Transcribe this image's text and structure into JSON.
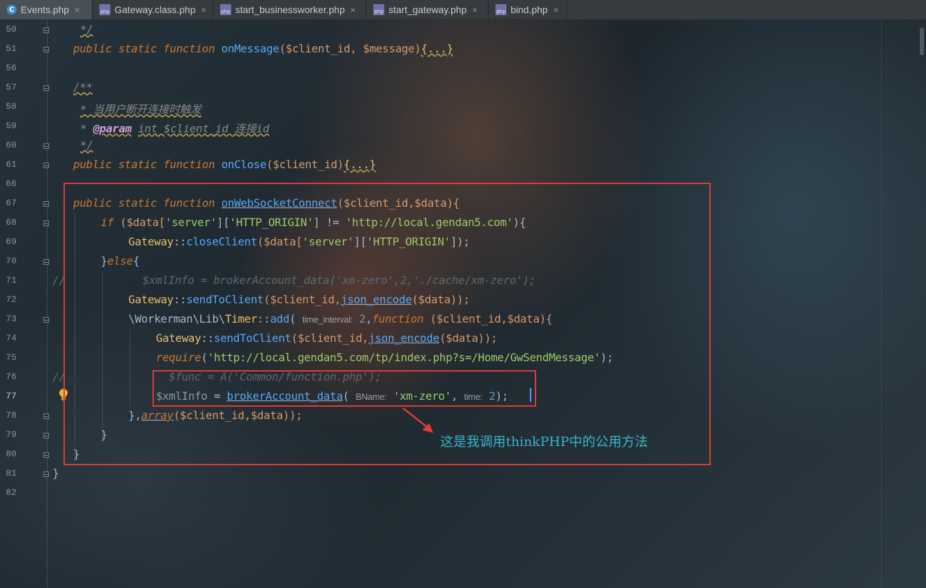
{
  "tabs": [
    {
      "label": "Events.php",
      "icon": "php-class-icon",
      "active": true
    },
    {
      "label": "Gateway.class.php",
      "icon": "php-file-icon",
      "active": false
    },
    {
      "label": "start_businessworker.php",
      "icon": "php-file-icon",
      "active": false
    },
    {
      "label": "start_gateway.php",
      "icon": "php-file-icon",
      "active": false
    },
    {
      "label": "bind.php",
      "icon": "php-file-icon",
      "active": false
    }
  ],
  "tab_close_glyph": "×",
  "class_icon_letter": "C",
  "php_icon_text": "php",
  "line_numbers": [
    "50",
    "51",
    "56",
    "57",
    "58",
    "59",
    "60",
    "61",
    "66",
    "67",
    "68",
    "69",
    "70",
    "71",
    "72",
    "73",
    "74",
    "75",
    "76",
    "77",
    "78",
    "79",
    "80",
    "81",
    "82"
  ],
  "code": {
    "l50": "*/",
    "l51_kw": "public static function",
    "l51_fn": "onMessage",
    "l51_args": "($client_id, $message)",
    "l51_fold": "{...}",
    "l57": "/**",
    "l58": "* 当用户断开连接时触发",
    "l59_star": "*",
    "l59_tag": "@param",
    "l59_rest": "int $client_id 连接id",
    "l60": "*/",
    "l61_kw": "public static function",
    "l61_fn": "onClose",
    "l61_args": "($client_id)",
    "l61_fold": "{...}",
    "l67_kw": "public static function",
    "l67_fn": "onWebSocketConnect",
    "l67_args": "($client_id,$data){",
    "l68_if": "if",
    "l68_a": "($data[",
    "l68_s1": "'server'",
    "l68_b": "][",
    "l68_s2": "'HTTP_ORIGIN'",
    "l68_c": "] != ",
    "l68_s3": "'http://local.gendan5.com'",
    "l68_d": "){",
    "l69_cls": "Gateway",
    "l69_a": "::",
    "l69_fn": "closeClient",
    "l69_b": "($data[",
    "l69_s1": "'server'",
    "l69_c": "][",
    "l69_s2": "'HTTP_ORIGIN'",
    "l69_d": "]);",
    "l70_a": "}",
    "l70_kw": "else",
    "l70_b": "{",
    "l71_slashes": "//",
    "l71_rest": "$xmlInfo = brokerAccount_data('xm-zero',2,'./cache/xm-zero');",
    "l72_cls": "Gateway",
    "l72_a": "::",
    "l72_fn": "sendToClient",
    "l72_b": "($client_id,",
    "l72_fn2": "json_encode",
    "l72_c": "($data));",
    "l73_a": "\\Workerman\\Lib\\",
    "l73_cls": "Timer",
    "l73_b": "::",
    "l73_fn": "add",
    "l73_c": "( ",
    "l73_hint": "time_interval:",
    "l73_num": " 2",
    "l73_d": ",",
    "l73_kw": "function",
    "l73_e": " ($client_id,$data){",
    "l74_cls": "Gateway",
    "l74_a": "::",
    "l74_fn": "sendToClient",
    "l74_b": "($client_id,",
    "l74_fn2": "json_encode",
    "l74_c": "($data));",
    "l75_kw": "require",
    "l75_a": "(",
    "l75_s": "'http://local.gendan5.com/tp/index.php?s=/Home/GwSendMessage'",
    "l75_b": ");",
    "l76_slashes": "//",
    "l76_rest": "$func = A('Common/function.php');",
    "l77_var": "$xmlInfo",
    "l77_a": " = ",
    "l77_fn": "brokerAccount_data",
    "l77_b": "( ",
    "l77_hint1": "BName:",
    "l77_s": " 'xm-zero'",
    "l77_c": ", ",
    "l77_hint2": "time:",
    "l77_num": " 2",
    "l77_d": ");",
    "l78_a": "},",
    "l78_kw": "array",
    "l78_b": "($client_id,$data));",
    "l79": "}",
    "l80": "}",
    "l81": "}"
  },
  "annotation": "这是我调用thinkPHP中的公用方法",
  "colors": {
    "highlight_box": "#e23a3a",
    "note_text": "#3ab7c6",
    "keyword": "#cc7832",
    "string": "#6a8759",
    "function": "#56a8f5"
  }
}
